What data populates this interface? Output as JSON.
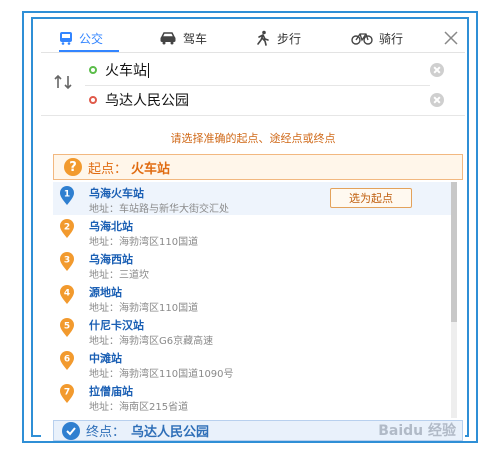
{
  "tabs": [
    {
      "label": "公交",
      "icon": "bus-icon",
      "active": true
    },
    {
      "label": "驾车",
      "icon": "car-icon",
      "active": false
    },
    {
      "label": "步行",
      "icon": "walk-icon",
      "active": false
    },
    {
      "label": "骑行",
      "icon": "bike-icon",
      "active": false
    }
  ],
  "route": {
    "start_value": "火车站",
    "end_value": "乌达人民公园"
  },
  "prompt": "请选择准确的起点、途经点或终点",
  "start_header": {
    "label": "起点：",
    "name": "火车站"
  },
  "results": [
    {
      "index": "1",
      "name": "乌海火车站",
      "address": "地址：车站路与新华大街交汇处",
      "selected": true
    },
    {
      "index": "2",
      "name": "乌海北站",
      "address": "地址：海勃湾区110国道"
    },
    {
      "index": "3",
      "name": "乌海西站",
      "address": "地址：三道坎"
    },
    {
      "index": "4",
      "name": "源地站",
      "address": "地址：海勃湾区110国道"
    },
    {
      "index": "5",
      "name": "什尼卡汉站",
      "address": "地址：海勃湾区G6京藏高速"
    },
    {
      "index": "6",
      "name": "中滩站",
      "address": "地址：海勃湾区110国道1090号"
    },
    {
      "index": "7",
      "name": "拉僧庙站",
      "address": "地址：海南区215省道"
    }
  ],
  "select_start_button": "选为起点",
  "end_bar": {
    "label": "终点：",
    "name": "乌达人民公园"
  },
  "watermark": "Baidu 经验",
  "colors": {
    "accent": "#3385ff",
    "marker_blue": "#2f7fd0",
    "marker_orange": "#f29a2e",
    "frame": "#2f8fd6"
  }
}
